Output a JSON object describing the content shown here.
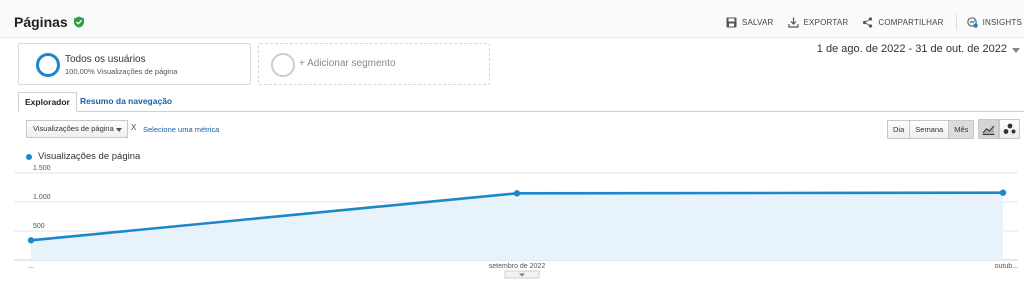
{
  "header": {
    "title": "Páginas",
    "actions": {
      "save": "SALVAR",
      "export": "EXPORTAR",
      "share": "COMPARTILHAR",
      "insights": "INSIGHTS"
    }
  },
  "segments": {
    "active": {
      "title": "Todos os usuários",
      "subtitle": "100,00% Visualizações de página"
    },
    "add": "+ Adicionar segmento"
  },
  "date_range": "1 de ago. de 2022 - 31 de out. de 2022",
  "tabs": {
    "explorer": "Explorador",
    "navigation": "Resumo da navegação"
  },
  "controls": {
    "metric": "Visualizações de página",
    "separator": "X",
    "select_metric": "Selecione uma métrica",
    "periods": [
      "Dia",
      "Semana",
      "Mês"
    ],
    "active_period": "Mês"
  },
  "colors": {
    "series": "#1c87c9",
    "fill": "#e7f2fb",
    "link": "#1a5ea8",
    "verified": "#2e9e4a"
  },
  "icons": [
    "save-icon",
    "export-icon",
    "share-icon",
    "insights-icon",
    "line-chart-icon",
    "motion-chart-icon"
  ],
  "chart_data": {
    "type": "area",
    "x": [
      "...",
      "setembro de 2022",
      "outub..."
    ],
    "series": [
      {
        "name": "Visualizações de página",
        "values": [
          340,
          1150,
          1160
        ]
      }
    ],
    "ylim": [
      0,
      1500
    ],
    "yticks": [
      "500",
      "1.000",
      "1.500"
    ],
    "ytick_values": [
      500,
      1000,
      1500
    ],
    "legend": "top-left",
    "grid": true
  }
}
